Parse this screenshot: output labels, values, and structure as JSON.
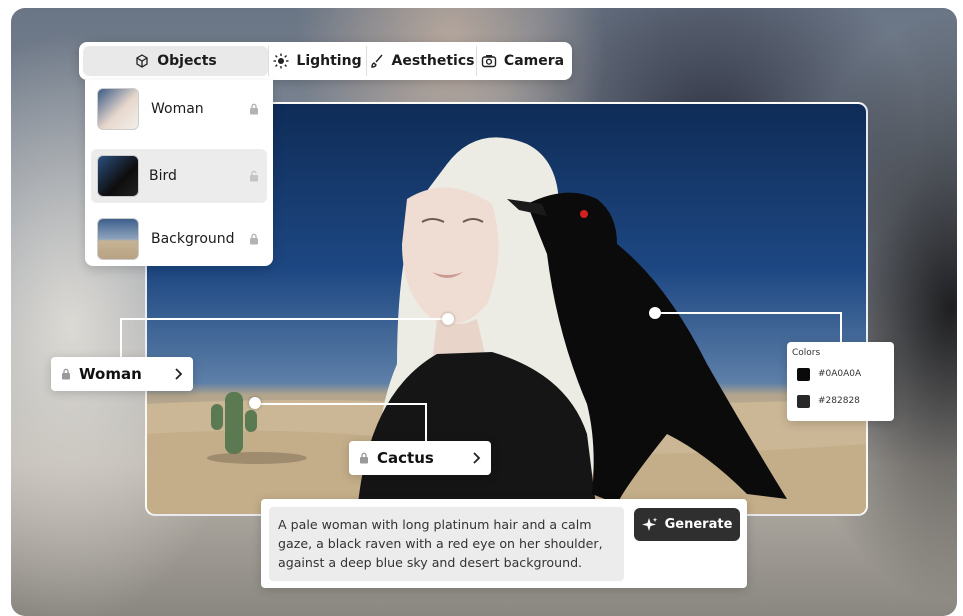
{
  "tabs": [
    {
      "label": "Objects",
      "icon": "cube-icon"
    },
    {
      "label": "Lighting",
      "icon": "sun-icon"
    },
    {
      "label": "Aesthetics",
      "icon": "brush-icon"
    },
    {
      "label": "Camera",
      "icon": "camera-icon"
    }
  ],
  "objects": [
    {
      "label": "Woman",
      "locked": true
    },
    {
      "label": "Bird",
      "locked": false
    },
    {
      "label": "Background",
      "locked": true
    }
  ],
  "callouts": {
    "woman": "Woman",
    "cactus": "Cactus"
  },
  "colors": {
    "title": "Colors",
    "swatches": [
      {
        "hex": "#0A0A0A",
        "label": "#0A0A0A"
      },
      {
        "hex": "#282828",
        "label": "#282828"
      }
    ]
  },
  "prompt": {
    "text": "A pale woman with long platinum hair and a calm gaze, a black raven with a red eye on her shoulder, against a deep blue sky and desert background.",
    "generate_label": "Generate"
  }
}
